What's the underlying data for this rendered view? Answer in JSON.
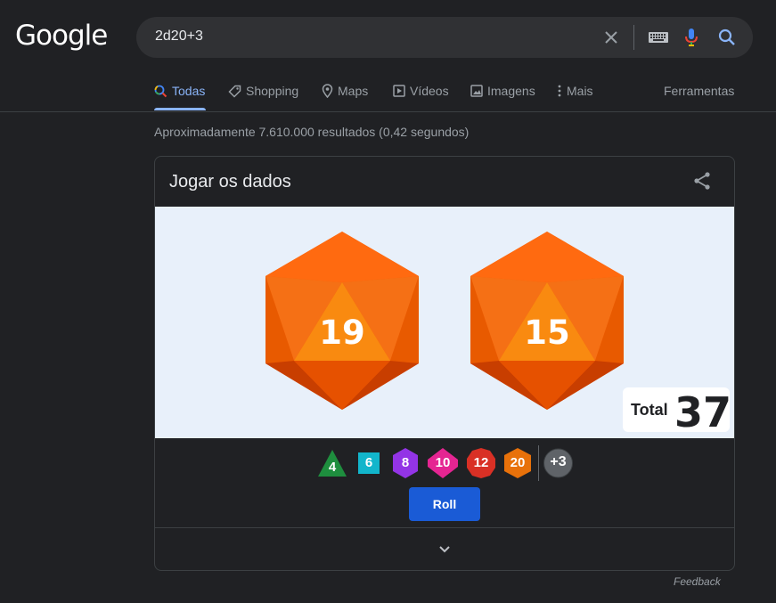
{
  "logo": "Google",
  "search": {
    "query": "2d20+3"
  },
  "tabs": [
    {
      "label": "Todas",
      "icon": "search-icon"
    },
    {
      "label": "Shopping",
      "icon": "tag-icon"
    },
    {
      "label": "Maps",
      "icon": "pin-icon"
    },
    {
      "label": "Vídeos",
      "icon": "play-icon"
    },
    {
      "label": "Imagens",
      "icon": "image-icon"
    },
    {
      "label": "Mais",
      "icon": "more-vert-icon"
    }
  ],
  "tools_label": "Ferramentas",
  "result_stats": "Aproximadamente 7.610.000 resultados (0,42 segundos)",
  "dice_card": {
    "title": "Jogar os dados",
    "results": [
      "19",
      "15"
    ],
    "total_label": "Total",
    "total_value": "37",
    "die_options": [
      {
        "label": "4",
        "shape": "triangle",
        "color": "#1e8e3e"
      },
      {
        "label": "6",
        "shape": "square",
        "color": "#12b5cb"
      },
      {
        "label": "8",
        "shape": "hexagon",
        "color": "#9334e6"
      },
      {
        "label": "10",
        "shape": "diamond",
        "color": "#e52592"
      },
      {
        "label": "12",
        "shape": "decagon",
        "color": "#d93025"
      },
      {
        "label": "20",
        "shape": "hexagon",
        "color": "#e8710a"
      }
    ],
    "modifier_label": "+3",
    "roll_label": "Roll"
  },
  "feedback_label": "Feedback",
  "colors": {
    "background": "#202124",
    "accent": "#8ab4f8",
    "die_orange": "#fa5a00",
    "roll_button": "#1a5bd6"
  }
}
